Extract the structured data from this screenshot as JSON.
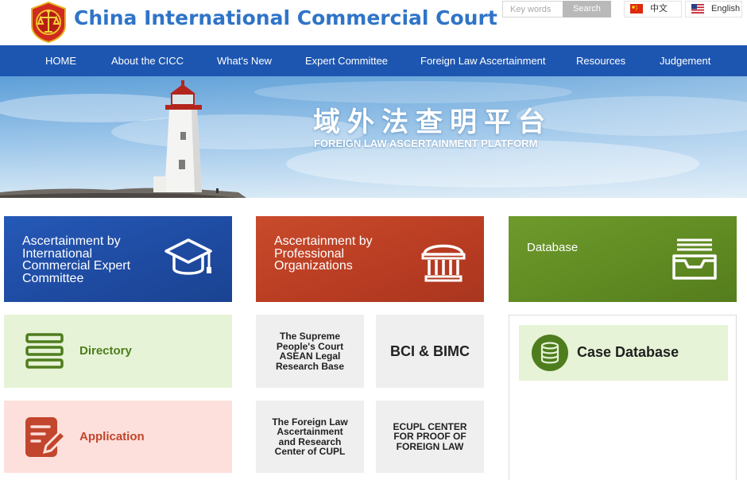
{
  "header": {
    "title": "China International Commercial Court",
    "search_placeholder": "Key words",
    "search_button": "Search",
    "lang_cn": "中文",
    "lang_en": "English"
  },
  "nav": {
    "items": [
      "HOME",
      "About the CICC",
      "What's New",
      "Expert Committee",
      "Foreign Law Ascertainment",
      "Resources",
      "Judgement"
    ]
  },
  "banner": {
    "title_cn": "域外法查明平台",
    "title_en": "FOREIGN LAW ASCERTAINMENT PLATFORM"
  },
  "tiles": {
    "expert": {
      "lines": [
        "Ascertainment by",
        "International",
        "Commercial Expert",
        "Committee"
      ],
      "icon": "graduation-cap-icon"
    },
    "organizations": {
      "lines": [
        "Ascertainment by",
        "Professional",
        "Organizations"
      ],
      "icon": "institution-building-icon"
    },
    "database": {
      "label": "Database",
      "icon": "inbox-tray-icon"
    },
    "directory": {
      "label": "Directory",
      "icon": "directory-list-icon"
    },
    "application": {
      "label": "Application",
      "icon": "edit-document-icon"
    },
    "asean": {
      "lines": [
        "The Supreme",
        "People's Court",
        "ASEAN Legal",
        "Research Base"
      ]
    },
    "bci": {
      "label": "BCI & BIMC"
    },
    "cupl": {
      "lines": [
        "The Foreign Law",
        "Ascertainment",
        "and Research",
        "Center of CUPL"
      ]
    },
    "ecupl": {
      "lines": [
        "ECUPL CENTER",
        "FOR PROOF OF",
        "FOREIGN LAW"
      ]
    },
    "case_database": {
      "label": "Case Database",
      "icon": "database-stack-icon"
    }
  },
  "colors": {
    "nav_blue": "#1d56b1",
    "title_blue": "#2f74c8",
    "tile_blue": "#2559b7",
    "tile_red": "#c94b2c",
    "tile_green": "#6f9a2c",
    "light_green": "#e6f3d6",
    "light_pink": "#fde0db",
    "directory_green": "#4e7d1e",
    "application_red": "#c2452d"
  }
}
